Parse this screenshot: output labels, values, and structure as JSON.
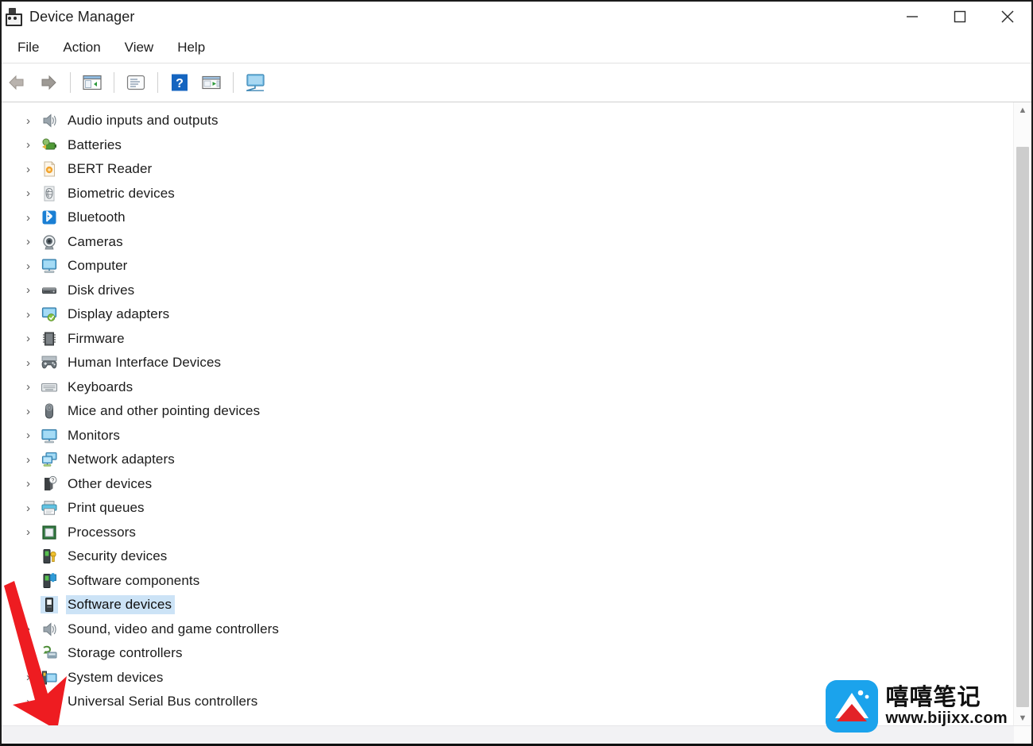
{
  "window": {
    "title": "Device Manager",
    "icon": "device-manager-icon",
    "controls": {
      "minimize": "minimize-icon",
      "maximize": "maximize-icon",
      "close": "close-icon"
    }
  },
  "menubar": {
    "items": [
      {
        "label": "File",
        "name": "menu-file"
      },
      {
        "label": "Action",
        "name": "menu-action"
      },
      {
        "label": "View",
        "name": "menu-view"
      },
      {
        "label": "Help",
        "name": "menu-help"
      }
    ]
  },
  "toolbar": {
    "buttons": [
      {
        "name": "back-button",
        "icon": "back-arrow-icon",
        "enabled": false
      },
      {
        "name": "forward-button",
        "icon": "forward-arrow-icon",
        "enabled": true
      },
      {
        "name": "show-hide-console-tree-button",
        "icon": "console-tree-icon",
        "enabled": true
      },
      {
        "name": "properties-button",
        "icon": "properties-window-icon",
        "enabled": true
      },
      {
        "name": "help-button",
        "icon": "help-question-icon",
        "enabled": true
      },
      {
        "name": "update-driver-button",
        "icon": "update-driver-icon",
        "enabled": true
      },
      {
        "name": "scan-hardware-changes-button",
        "icon": "monitor-scan-icon",
        "enabled": true
      }
    ]
  },
  "tree": {
    "selected_index": 20,
    "items": [
      {
        "label": "Audio inputs and outputs",
        "icon": "speaker-icon",
        "expandable": true
      },
      {
        "label": "Batteries",
        "icon": "battery-icon",
        "expandable": true
      },
      {
        "label": "BERT Reader",
        "icon": "bert-reader-icon",
        "expandable": true
      },
      {
        "label": "Biometric devices",
        "icon": "fingerprint-icon",
        "expandable": true
      },
      {
        "label": "Bluetooth",
        "icon": "bluetooth-icon",
        "expandable": true
      },
      {
        "label": "Cameras",
        "icon": "camera-icon",
        "expandable": true
      },
      {
        "label": "Computer",
        "icon": "computer-icon",
        "expandable": true
      },
      {
        "label": "Disk drives",
        "icon": "disk-drive-icon",
        "expandable": true
      },
      {
        "label": "Display adapters",
        "icon": "display-adapter-icon",
        "expandable": true
      },
      {
        "label": "Firmware",
        "icon": "firmware-chip-icon",
        "expandable": true
      },
      {
        "label": "Human Interface Devices",
        "icon": "gamepad-icon",
        "expandable": true
      },
      {
        "label": "Keyboards",
        "icon": "keyboard-icon",
        "expandable": true
      },
      {
        "label": "Mice and other pointing devices",
        "icon": "mouse-icon",
        "expandable": true
      },
      {
        "label": "Monitors",
        "icon": "monitor-icon",
        "expandable": true
      },
      {
        "label": "Network adapters",
        "icon": "network-adapter-icon",
        "expandable": true
      },
      {
        "label": "Other devices",
        "icon": "other-device-icon",
        "expandable": true
      },
      {
        "label": "Print queues",
        "icon": "printer-icon",
        "expandable": true
      },
      {
        "label": "Processors",
        "icon": "processor-icon",
        "expandable": true
      },
      {
        "label": "Security devices",
        "icon": "security-device-icon",
        "expandable": false
      },
      {
        "label": "Software components",
        "icon": "software-component-icon",
        "expandable": false
      },
      {
        "label": "Software devices",
        "icon": "software-device-icon",
        "expandable": false
      },
      {
        "label": "Sound, video and game controllers",
        "icon": "speaker-icon",
        "expandable": true
      },
      {
        "label": "Storage controllers",
        "icon": "storage-controller-icon",
        "expandable": true
      },
      {
        "label": "System devices",
        "icon": "system-device-icon",
        "expandable": true
      },
      {
        "label": "Universal Serial Bus controllers",
        "icon": "usb-icon",
        "expandable": true
      }
    ]
  },
  "scrollbars": {
    "vertical": {
      "up_glyph": "▲",
      "down_glyph": "▼"
    }
  },
  "annotation": {
    "arrow": {
      "name": "red-pointer-arrow",
      "color": "#ee1c21",
      "points_to": "Sound, video and game controllers"
    }
  },
  "watermark": {
    "brand_cn": "嘻嘻笔记",
    "url": "www.bijixx.com",
    "logo_colors": {
      "background": "#1ba3ec",
      "mountain": "#e32227",
      "snow": "#ffffff"
    }
  },
  "colors": {
    "selection": "#cce3f6",
    "text": "#1b1b1b",
    "toolbar_border": "#cfcfcf"
  }
}
